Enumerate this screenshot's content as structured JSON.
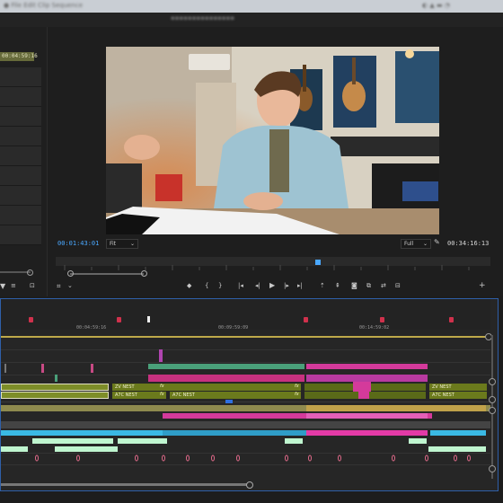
{
  "program_monitor": {
    "current_timecode": "00:01:43:01",
    "duration_timecode": "00:34:16:13",
    "zoom_value": "Fit",
    "resolution_value": "Full"
  },
  "source_panel": {
    "timecode": "00:04:59:16"
  },
  "timeline": {
    "ruler_timecodes": [
      "00:04:59:16",
      "00:09:59:09",
      "00:14:59:02"
    ],
    "nest_labels": {
      "zv": "ZV NEST",
      "a7c": "A7C NEST"
    },
    "fx_label": "fx"
  },
  "icons": [
    "wrench-icon",
    "play-icon",
    "step-back-icon",
    "step-forward-icon",
    "marker-icon",
    "export-frame-icon",
    "plus-icon"
  ],
  "colors": {
    "timecode_blue": "#4aa8ff",
    "nest_green": "#6b7a1c",
    "clip_pink": "#d43a9b",
    "clip_cyan": "#3ab9e4",
    "clip_mint": "#bff5cf",
    "marker_red": "#d0314c",
    "selection_blue": "#2f5fa8"
  }
}
